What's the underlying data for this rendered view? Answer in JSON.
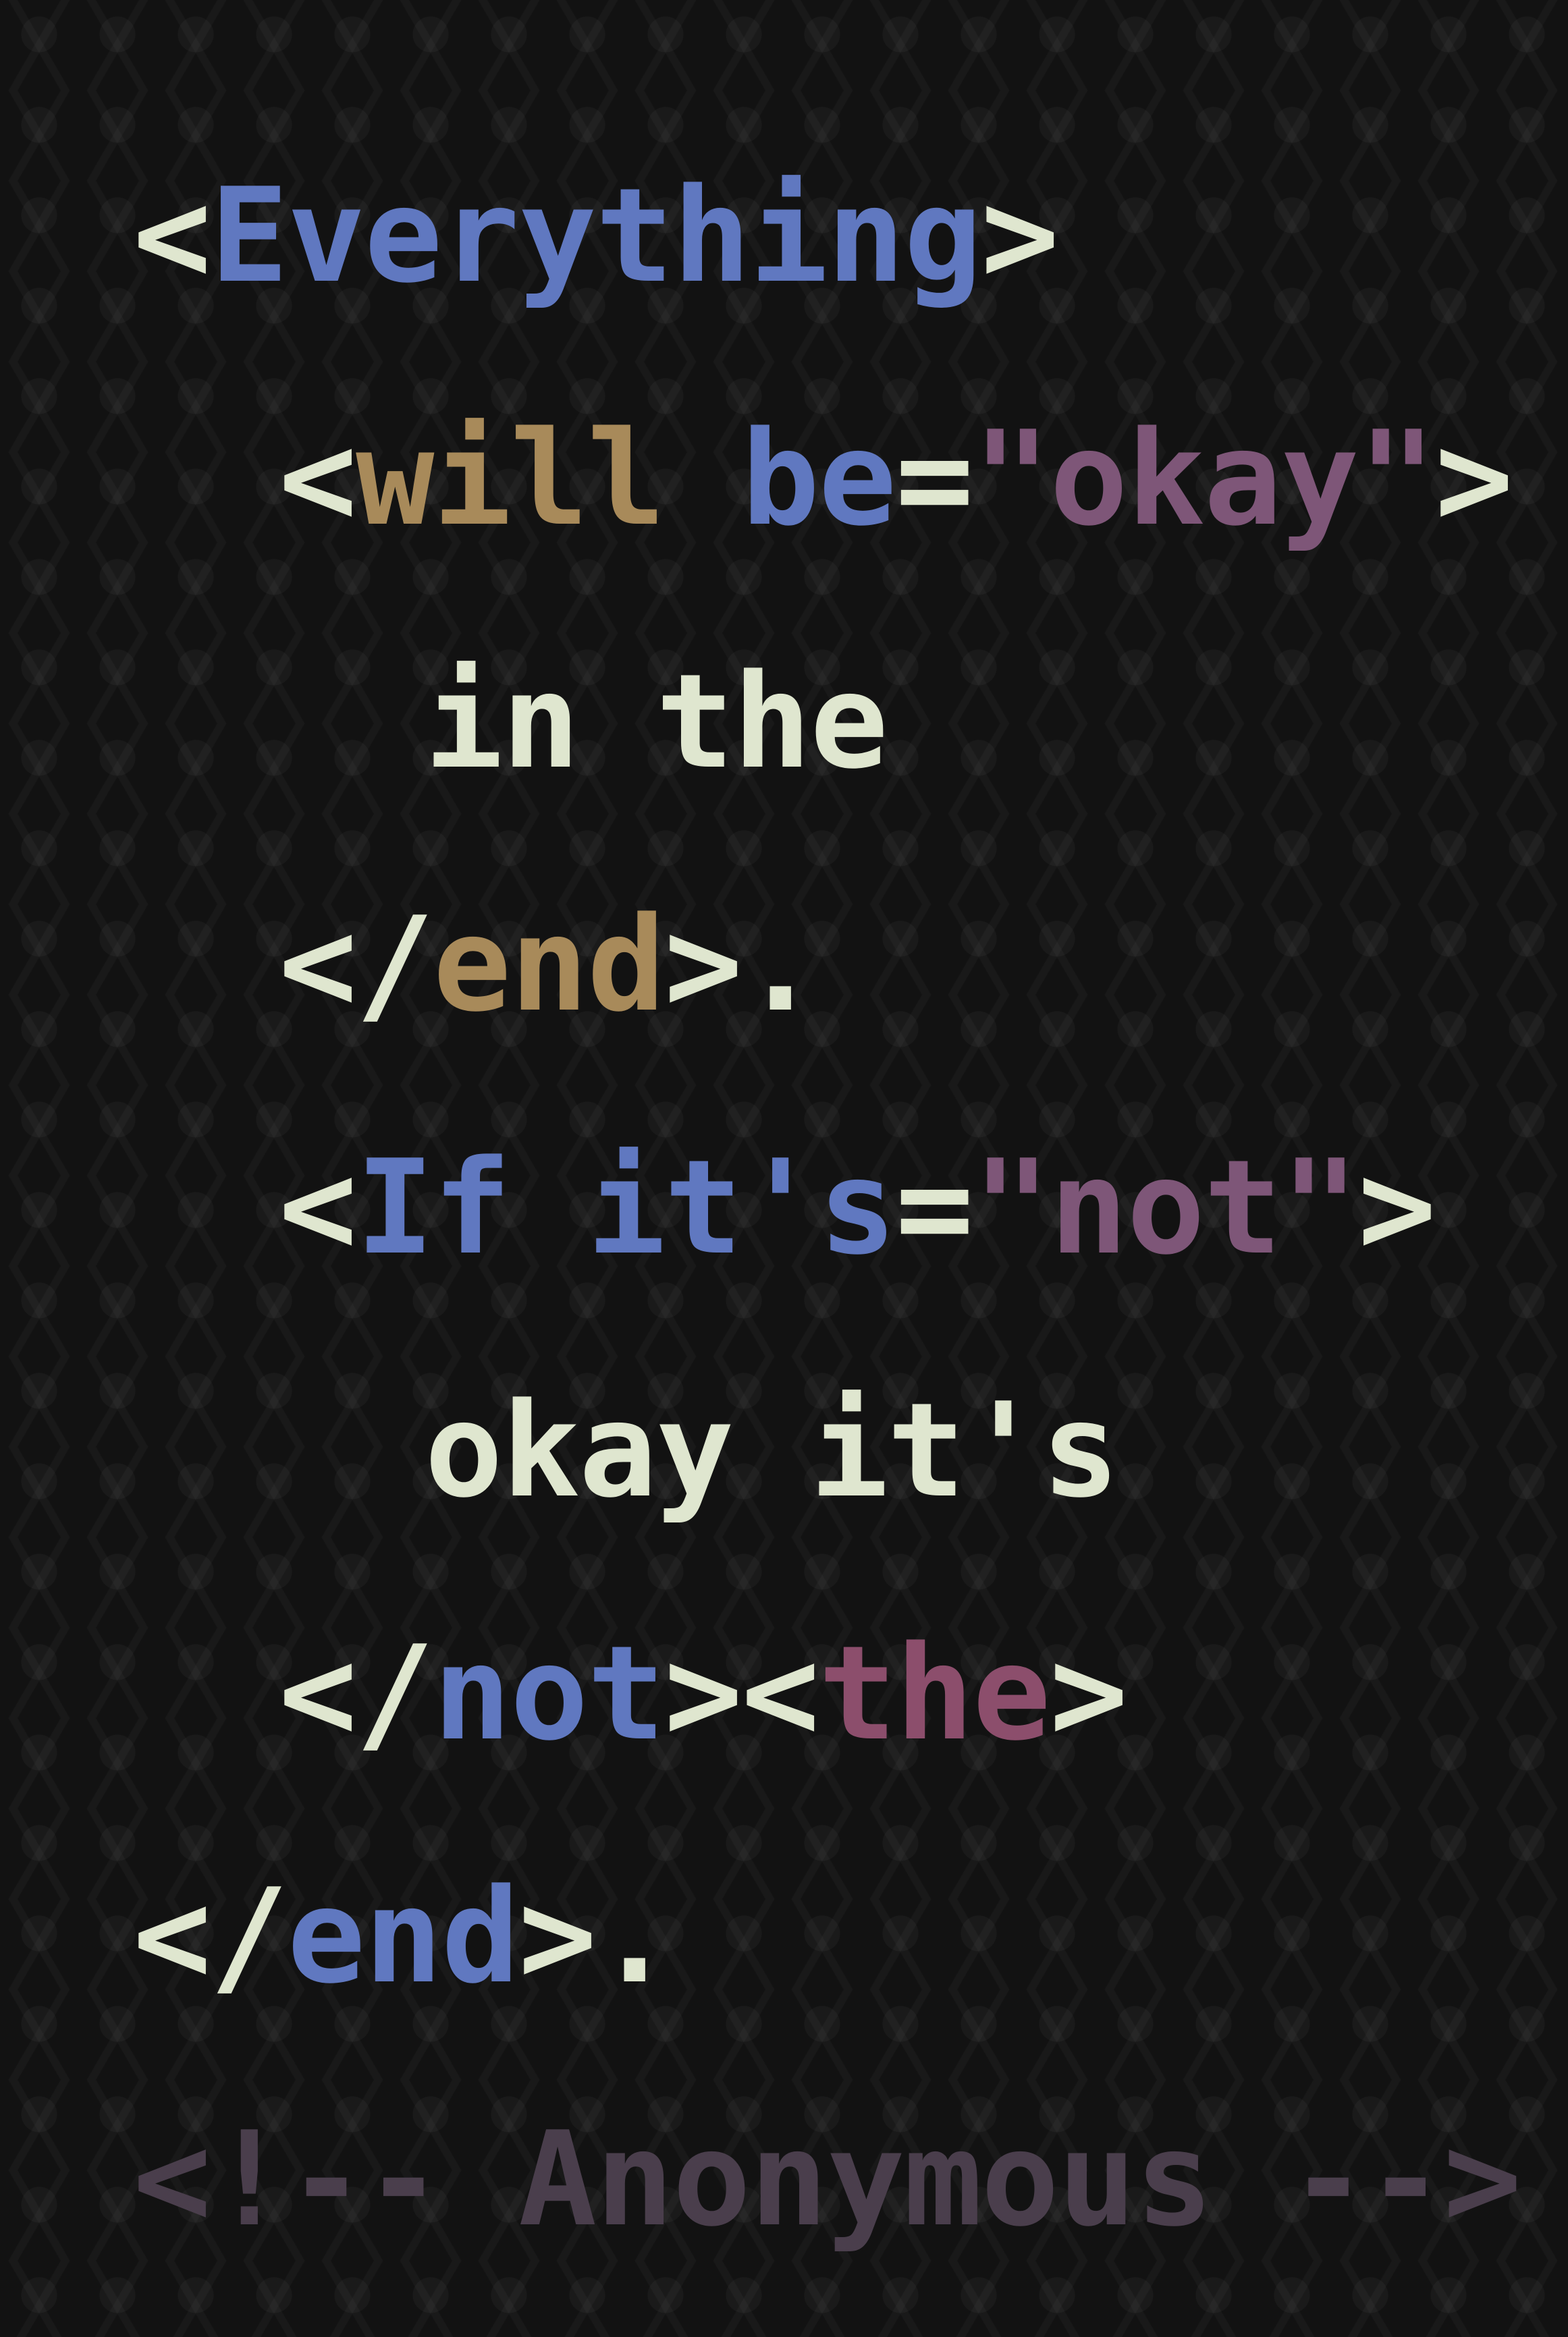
{
  "colors": {
    "background": "#121212",
    "punctuation": "#dfe6cf",
    "tag_blue": "#6078c0",
    "tag_tan": "#a88a5a",
    "string_purple": "#7e5678",
    "tag_rose": "#8c4e6c",
    "comment": "#4a3e4c"
  },
  "lines": [
    {
      "indent": 0,
      "tokens": [
        {
          "text": "<",
          "color": "#dfe6cf"
        },
        {
          "text": "Everything",
          "color": "#6078c0"
        },
        {
          "text": ">",
          "color": "#dfe6cf"
        }
      ]
    },
    {
      "indent": 1,
      "tokens": [
        {
          "text": "<",
          "color": "#dfe6cf"
        },
        {
          "text": "will",
          "color": "#a88a5a"
        },
        {
          "text": " ",
          "color": "#dfe6cf"
        },
        {
          "text": "be",
          "color": "#6078c0"
        },
        {
          "text": "=",
          "color": "#dfe6cf"
        },
        {
          "text": "\"okay\"",
          "color": "#7e5678"
        },
        {
          "text": ">",
          "color": "#dfe6cf"
        }
      ]
    },
    {
      "indent": 2,
      "tokens": [
        {
          "text": "in the",
          "color": "#dfe6cf"
        }
      ]
    },
    {
      "indent": 1,
      "tokens": [
        {
          "text": "</",
          "color": "#dfe6cf"
        },
        {
          "text": "end",
          "color": "#a88a5a"
        },
        {
          "text": ">.",
          "color": "#dfe6cf"
        }
      ]
    },
    {
      "indent": 1,
      "tokens": [
        {
          "text": "<",
          "color": "#dfe6cf"
        },
        {
          "text": "If it's",
          "color": "#6078c0"
        },
        {
          "text": "=",
          "color": "#dfe6cf"
        },
        {
          "text": "\"not\"",
          "color": "#7e5678"
        },
        {
          "text": ">",
          "color": "#dfe6cf"
        }
      ]
    },
    {
      "indent": 2,
      "tokens": [
        {
          "text": "okay it's",
          "color": "#dfe6cf"
        }
      ]
    },
    {
      "indent": 1,
      "tokens": [
        {
          "text": "</",
          "color": "#dfe6cf"
        },
        {
          "text": "not",
          "color": "#6078c0"
        },
        {
          "text": "><",
          "color": "#dfe6cf"
        },
        {
          "text": "the",
          "color": "#8c4e6c"
        },
        {
          "text": ">",
          "color": "#dfe6cf"
        }
      ]
    },
    {
      "indent": 0,
      "tokens": [
        {
          "text": "</",
          "color": "#dfe6cf"
        },
        {
          "text": "end",
          "color": "#6078c0"
        },
        {
          "text": ">.",
          "color": "#dfe6cf"
        }
      ]
    },
    {
      "indent": 0,
      "tokens": [
        {
          "text": "<!-- Anonymous -->",
          "color": "#4a3e4c"
        }
      ]
    }
  ]
}
